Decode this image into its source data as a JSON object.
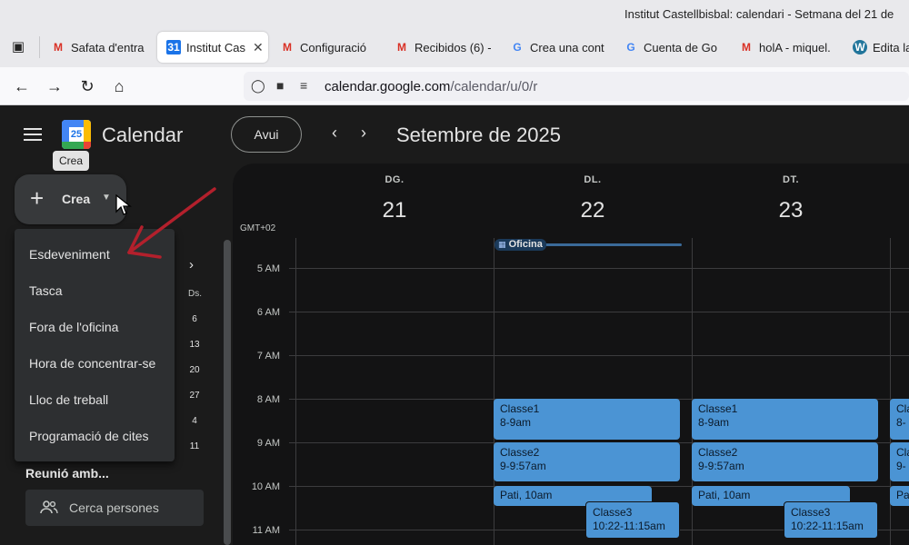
{
  "browser": {
    "window_title": "Institut Castellbisbal: calendari - Setmana del 21 de",
    "tabs": [
      {
        "label": "Safata d'entra",
        "icon": "gmail-icon",
        "active": false
      },
      {
        "label": "Institut Cas",
        "icon": "calendar-icon",
        "active": true
      },
      {
        "label": "Configuració",
        "icon": "gmail-icon",
        "active": false
      },
      {
        "label": "Recibidos (6) -",
        "icon": "gmail-icon",
        "active": false
      },
      {
        "label": "Crea una cont",
        "icon": "google-icon",
        "active": false
      },
      {
        "label": "Cuenta de Go",
        "icon": "google-icon",
        "active": false
      },
      {
        "label": "holA - miquel.",
        "icon": "gmail-icon",
        "active": false
      },
      {
        "label": "Edita la",
        "icon": "wordpress-icon",
        "active": false
      }
    ],
    "url_domain": "calendar.google.com",
    "url_path": "/calendar/u/0/r"
  },
  "app": {
    "name": "Calendar",
    "logo_number": "25",
    "today_button": "Avui",
    "month_title": "Setembre de 2025",
    "tooltip": "Crea",
    "create_button": "Crea"
  },
  "create_menu": {
    "items": [
      "Esdeveniment",
      "Tasca",
      "Fora de l'oficina",
      "Hora de concentrar-se",
      "Lloc de treball",
      "Programació de cites"
    ]
  },
  "mini_calendar": {
    "dow_label": "Ds.",
    "days": [
      "6",
      "13",
      "20",
      "27",
      "4",
      "11"
    ]
  },
  "people": {
    "section_title": "Reunió amb...",
    "search_placeholder": "Cerca persones"
  },
  "week": {
    "timezone": "GMT+02",
    "days": [
      {
        "dow": "DG.",
        "num": "21"
      },
      {
        "dow": "DL.",
        "num": "22"
      },
      {
        "dow": "DT.",
        "num": "23"
      }
    ],
    "hours": [
      "5 AM",
      "6 AM",
      "7 AM",
      "8 AM",
      "9 AM",
      "10 AM",
      "11 AM"
    ],
    "all_day_event": "Oficina",
    "events": [
      {
        "title": "Classe1",
        "time": "8-9am"
      },
      {
        "title": "Classe2",
        "time": "9-9:57am"
      },
      {
        "title": "Pati",
        "time": "10am"
      },
      {
        "title": "Classe3",
        "time": "10:22-11:15am"
      }
    ],
    "cut_events": [
      "Cla",
      "8-",
      "Cla",
      "9-",
      "Pa"
    ]
  },
  "colors": {
    "event_blue": "#4b94d4",
    "dark_bg": "#1b1b1b",
    "grid_bg": "#131314",
    "annotation_red": "#b3202c"
  }
}
